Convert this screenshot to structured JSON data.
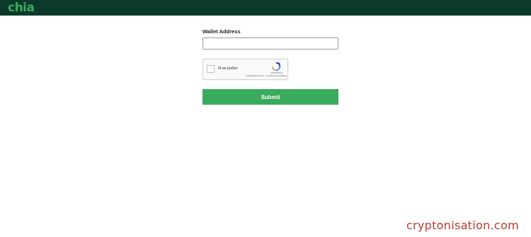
{
  "header": {
    "logo_text": "chia",
    "background_color": "#0b3a2c",
    "logo_color": "#3aaa5c"
  },
  "form": {
    "wallet_label": "Wallet Address",
    "wallet_value": "",
    "submit_label": "Submit",
    "submit_color": "#3aaa5c"
  },
  "captcha": {
    "checkbox_checked": false,
    "label": "Я не робот",
    "brand": "reCAPTCHA",
    "links": "Конфиденциальность - Условия использования",
    "icon": "recaptcha-icon"
  },
  "watermark": {
    "text": "cryptonisation.com",
    "color": "#c0392b"
  }
}
